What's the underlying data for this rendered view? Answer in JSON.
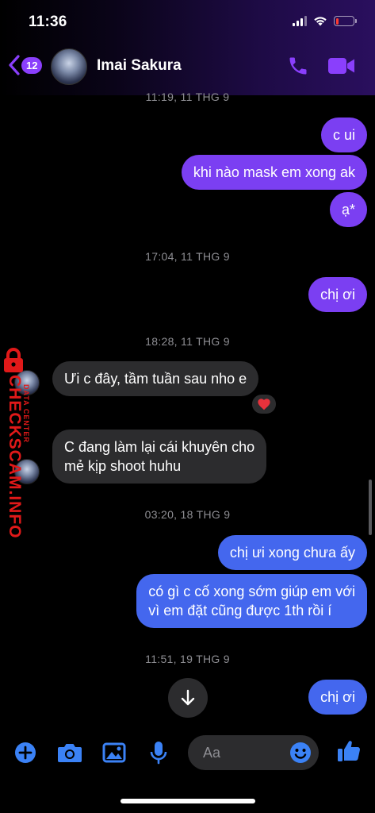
{
  "status_bar": {
    "time": "11:36",
    "battery_level": 0.15
  },
  "header": {
    "back_count": "12",
    "contact_name": "Imai Sakura"
  },
  "messages": {
    "ts1": "11:19, 11 THG 9",
    "m1": "c ui",
    "m2": "khi nào mask em xong ak",
    "m3": "ạ*",
    "ts2": "17:04, 11 THG 9",
    "m4": "chị ơi",
    "ts3": "18:28, 11 THG 9",
    "m5": "Ưi c đây, tầm tuần sau nho e",
    "m5_reaction": "heart-emoji",
    "m6_line1": "C đang làm lại cái khuyên cho",
    "m6_line2": "mẻ kịp shoot huhu",
    "ts4": "03:20, 18 THG 9",
    "m7": "chị ưi xong chưa ấy",
    "m8_line1": "có gì c cố xong sớm giúp em với",
    "m8_line2": "vì em đặt cũng được 1th rồi í",
    "ts5": "11:51, 19 THG 9",
    "m9": "chị ơi"
  },
  "watermark": {
    "main": "CHECKSCAM.INFO",
    "sub": "DATA CENTER"
  },
  "composer": {
    "placeholder": "Aa"
  },
  "colors": {
    "accent": "#8a3ffc",
    "bubble_out_purple": "#7b3ff2",
    "bubble_out_blue": "#4467ee",
    "bubble_in": "#2c2c2e",
    "composer_icon": "#3b82f6",
    "watermark": "#e01919"
  },
  "icons": [
    "back-chevron-icon",
    "phone-icon",
    "video-camera-icon",
    "heart-icon",
    "arrow-down-icon",
    "plus-icon",
    "camera-icon",
    "image-icon",
    "microphone-icon",
    "smiley-icon",
    "thumbs-up-icon",
    "lock-icon"
  ]
}
